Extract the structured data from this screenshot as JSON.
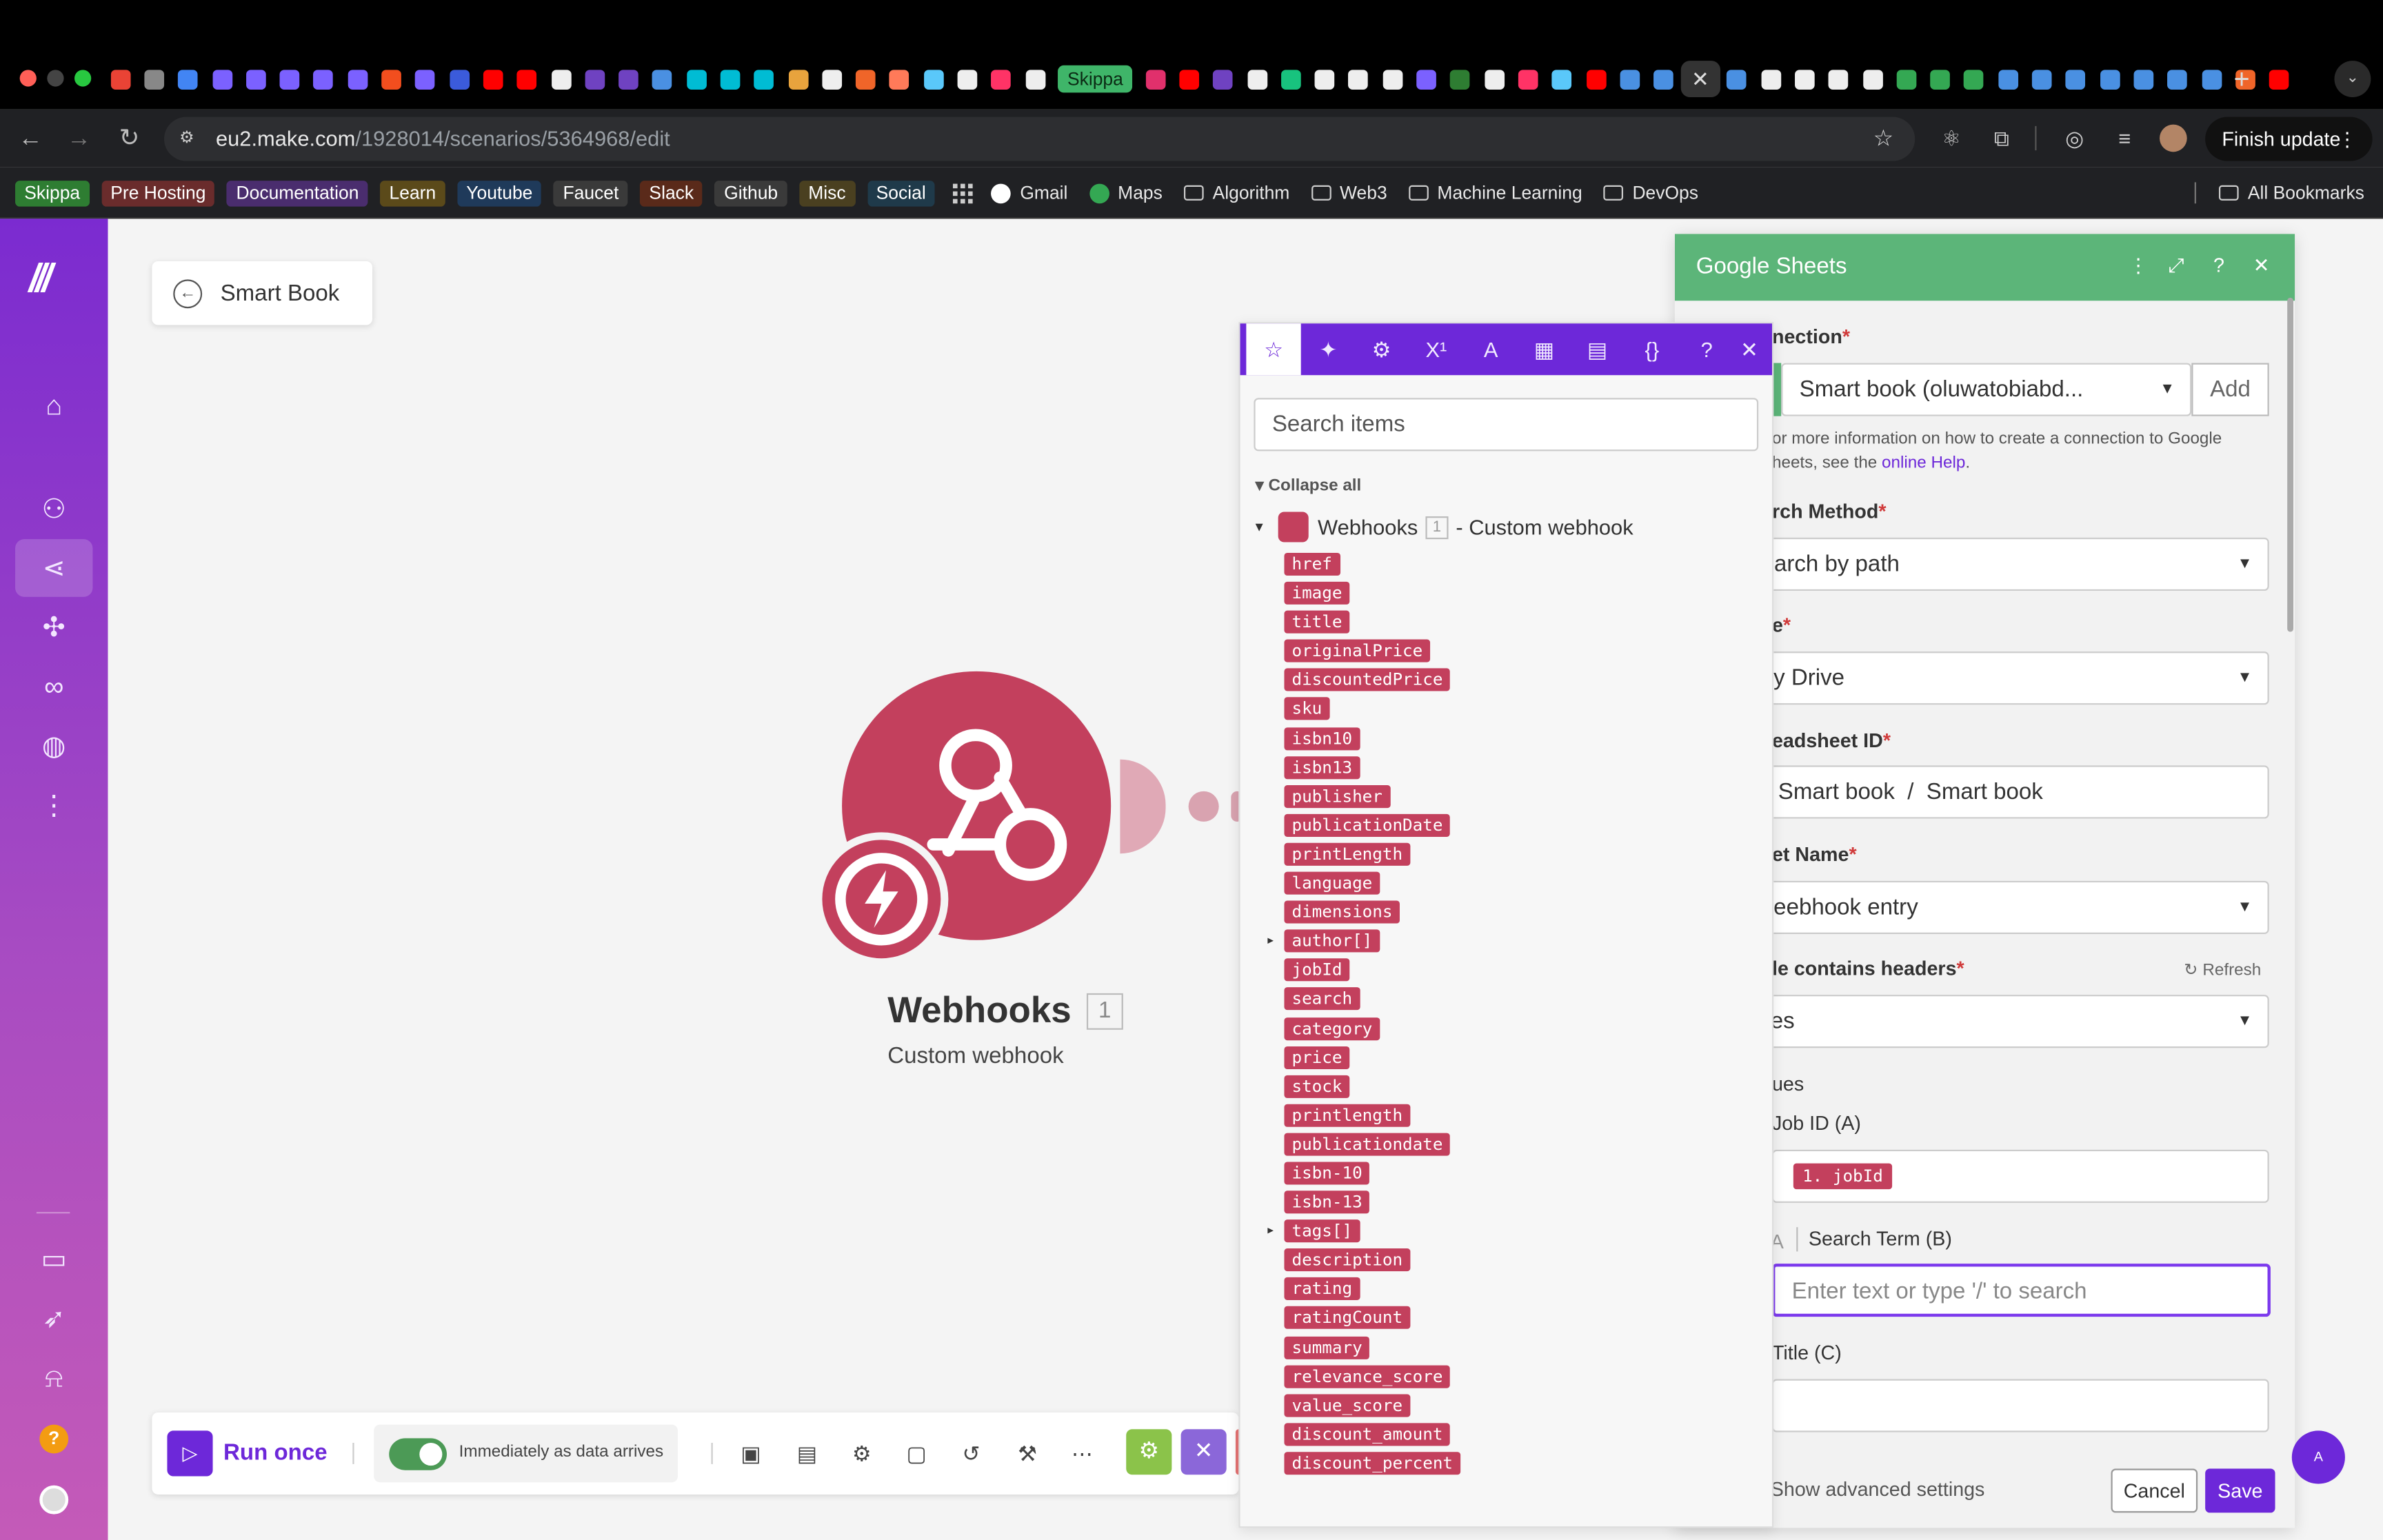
{
  "browser": {
    "url_domain": "eu2.make.com",
    "url_path": "/1928014/scenarios/5364968/edit",
    "finish_update": "Finish update",
    "skippa_tab": "Skippa",
    "active_tab_close": "✕",
    "new_tab": "+",
    "favicon_colors": [
      "#ea4335",
      "#888",
      "#4285f4",
      "#7b61ff",
      "#7b61ff",
      "#7b61ff",
      "#7b61ff",
      "#7b61ff",
      "#f24e1e",
      "#7b61ff",
      "#3b5bdb",
      "#ff0000",
      "#ff0000",
      "#eeeeee",
      "#6f42c1",
      "#6f42c1",
      "#4a90e2",
      "#00bcd4",
      "#00bcd4",
      "#00bcd4",
      "#e8a33d",
      "#eeeeee",
      "#f06529",
      "#ff7a59",
      "#5ac8fa",
      "#eeeeee",
      "#ff3366",
      "#eeeeee"
    ],
    "favicon_colors_2": [
      "#e1306c",
      "#ff0000",
      "#6f42c1",
      "#eeeeee",
      "#18c37e",
      "#eeeeee",
      "#eeeeee",
      "#eeeeee",
      "#7b61ff",
      "#2e7d32",
      "#eeeeee",
      "#ff3366",
      "#5ac8fa",
      "#ff0000",
      "#4a90e2",
      "#4a90e2"
    ],
    "favicon_colors_3": [
      "#4a90e2",
      "#eeeeee",
      "#eeeeee",
      "#eeeeee",
      "#eeeeee",
      "#34a853",
      "#34a853",
      "#34a853",
      "#4a90e2",
      "#4a90e2",
      "#4a90e2",
      "#4a90e2",
      "#4a90e2",
      "#4a90e2",
      "#4a90e2",
      "#f06529",
      "#ff0000"
    ]
  },
  "bookmarks": {
    "pills": [
      {
        "label": "Skippa",
        "color": "#2e7d32"
      },
      {
        "label": "Pre Hosting",
        "color": "#6a2c2c"
      },
      {
        "label": "Documentation",
        "color": "#4a2d6e"
      },
      {
        "label": "Learn",
        "color": "#5b4a1a"
      },
      {
        "label": "Youtube",
        "color": "#1f3a5a"
      },
      {
        "label": "Faucet",
        "color": "#3a3a3a"
      },
      {
        "label": "Slack",
        "color": "#5a2a1a"
      },
      {
        "label": "Github",
        "color": "#3a3a3a"
      },
      {
        "label": "Misc",
        "color": "#4a4020"
      },
      {
        "label": "Social",
        "color": "#1f3a4a"
      }
    ],
    "links": [
      "Gmail",
      "Maps"
    ],
    "folders": [
      "Algorithm",
      "Web3",
      "Machine Learning",
      "DevOps"
    ],
    "all": "All Bookmarks"
  },
  "scenario": {
    "name": "Smart Book",
    "node_title": "Webhooks",
    "node_badge": "1",
    "node_subtitle": "Custom webhook"
  },
  "toolbar": {
    "run_once": "Run once",
    "schedule": "Immediately as data arrives"
  },
  "mapping": {
    "search_placeholder": "Search items",
    "collapse_all": "Collapse all",
    "module_name": "Webhooks",
    "module_badge": "1",
    "module_suffix": "- Custom webhook",
    "items": [
      {
        "label": "href"
      },
      {
        "label": "image"
      },
      {
        "label": "title"
      },
      {
        "label": "originalPrice"
      },
      {
        "label": "discountedPrice"
      },
      {
        "label": "sku"
      },
      {
        "label": "isbn10"
      },
      {
        "label": "isbn13"
      },
      {
        "label": "publisher"
      },
      {
        "label": "publicationDate"
      },
      {
        "label": "printLength"
      },
      {
        "label": "language"
      },
      {
        "label": "dimensions"
      },
      {
        "label": "author[]",
        "expandable": true
      },
      {
        "label": "jobId"
      },
      {
        "label": "search"
      },
      {
        "label": "category"
      },
      {
        "label": "price"
      },
      {
        "label": "stock"
      },
      {
        "label": "printlength"
      },
      {
        "label": "publicationdate"
      },
      {
        "label": "isbn-10"
      },
      {
        "label": "isbn-13"
      },
      {
        "label": "tags[]",
        "expandable": true
      },
      {
        "label": "description"
      },
      {
        "label": "rating"
      },
      {
        "label": "ratingCount"
      },
      {
        "label": "summary"
      },
      {
        "label": "relevance_score"
      },
      {
        "label": "value_score"
      },
      {
        "label": "discount_amount"
      },
      {
        "label": "discount_percent"
      }
    ]
  },
  "sheets": {
    "title": "Google Sheets",
    "connection_label": "nection",
    "connection_value": "Smart book (oluwatobiabd...",
    "add": "Add",
    "help_line1": "or more information on how to create a connection to Google",
    "help_line2": "heets, see the",
    "help_link": "online Help",
    "help_end": ".",
    "search_method_label": "rch Method",
    "search_method_value": "earch by path",
    "drive_label": "e",
    "drive_value": "y Drive",
    "spreadsheet_label": "eadsheet ID",
    "spreadsheet_value": "Smart book  /  Smart book",
    "sheet_label": "et Name",
    "sheet_value": "eebhook entry",
    "headers_label": "le contains headers",
    "refresh": "Refresh",
    "headers_value": "es",
    "values_label": "ues",
    "jobid_label": "Job ID (A)",
    "jobid_value": "1. jobId",
    "search_term_label": "Search Term (B)",
    "search_term_placeholder": "Enter text or type '/' to search",
    "title_label": "Title (C)",
    "advanced": "Show advanced settings",
    "cancel": "Cancel",
    "save": "Save",
    "required_mark": "*",
    "green": "#5cb579",
    "purple": "#6d28d9",
    "pill_color": "#c3405d"
  }
}
